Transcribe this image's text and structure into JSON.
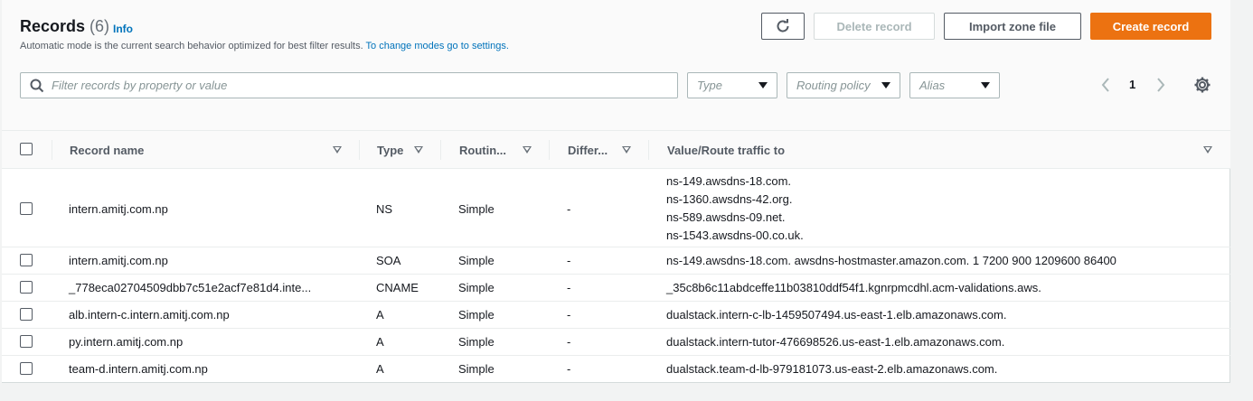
{
  "header": {
    "title": "Records",
    "count": "(6)",
    "info_label": "Info",
    "description": "Automatic mode is the current search behavior optimized for best filter results.",
    "description_link": "To change modes go to settings."
  },
  "toolbar": {
    "delete_label": "Delete record",
    "import_label": "Import zone file",
    "create_label": "Create record"
  },
  "filters": {
    "search_placeholder": "Filter records by property or value",
    "type_placeholder": "Type",
    "routing_placeholder": "Routing policy",
    "alias_placeholder": "Alias"
  },
  "pagination": {
    "page": "1"
  },
  "table": {
    "columns": [
      "Record name",
      "Type",
      "Routin...",
      "Differ...",
      "Value/Route traffic to"
    ],
    "rows": [
      {
        "name": "intern.amitj.com.np",
        "type": "NS",
        "routing": "Simple",
        "differ": "-",
        "values": [
          "ns-149.awsdns-18.com.",
          "ns-1360.awsdns-42.org.",
          "ns-589.awsdns-09.net.",
          "ns-1543.awsdns-00.co.uk."
        ]
      },
      {
        "name": "intern.amitj.com.np",
        "type": "SOA",
        "routing": "Simple",
        "differ": "-",
        "values": [
          "ns-149.awsdns-18.com. awsdns-hostmaster.amazon.com. 1 7200 900 1209600 86400"
        ]
      },
      {
        "name": "_778eca02704509dbb7c51e2acf7e81d4.inte...",
        "type": "CNAME",
        "routing": "Simple",
        "differ": "-",
        "values": [
          "_35c8b6c11abdceffe11b03810ddf54f1.kgnrpmcdhl.acm-validations.aws."
        ]
      },
      {
        "name": "alb.intern-c.intern.amitj.com.np",
        "type": "A",
        "routing": "Simple",
        "differ": "-",
        "values": [
          "dualstack.intern-c-lb-1459507494.us-east-1.elb.amazonaws.com."
        ]
      },
      {
        "name": "py.intern.amitj.com.np",
        "type": "A",
        "routing": "Simple",
        "differ": "-",
        "values": [
          "dualstack.intern-tutor-476698526.us-east-1.elb.amazonaws.com."
        ]
      },
      {
        "name": "team-d.intern.amitj.com.np",
        "type": "A",
        "routing": "Simple",
        "differ": "-",
        "values": [
          "dualstack.team-d-lb-979181073.us-east-2.elb.amazonaws.com."
        ]
      }
    ]
  }
}
